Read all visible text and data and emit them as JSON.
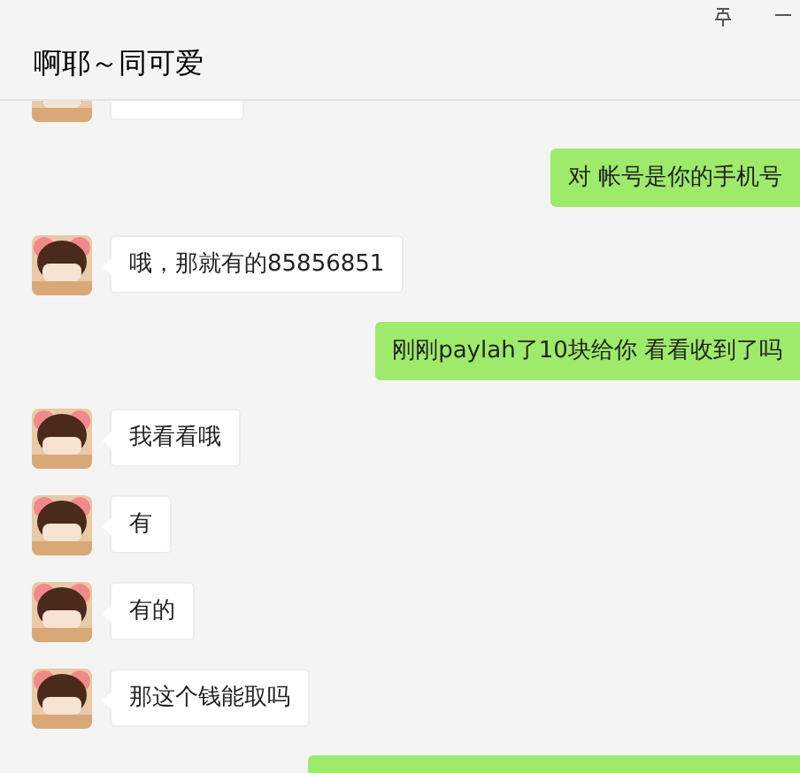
{
  "header": {
    "title": "啊耶～同可爱"
  },
  "messages": [
    {
      "kind": "received"
    },
    {
      "kind": "sent",
      "text": "对 帐号是你的手机号"
    },
    {
      "kind": "received",
      "text": "哦，那就有的85856851"
    },
    {
      "kind": "sent",
      "text": "刚刚paylah了10块给你 看看收到了吗"
    },
    {
      "kind": "received",
      "text": "我看看哦"
    },
    {
      "kind": "received",
      "text": "有"
    },
    {
      "kind": "received",
      "text": "有的"
    },
    {
      "kind": "received",
      "text": "那这个钱能取吗"
    },
    {
      "kind": "sent"
    }
  ]
}
